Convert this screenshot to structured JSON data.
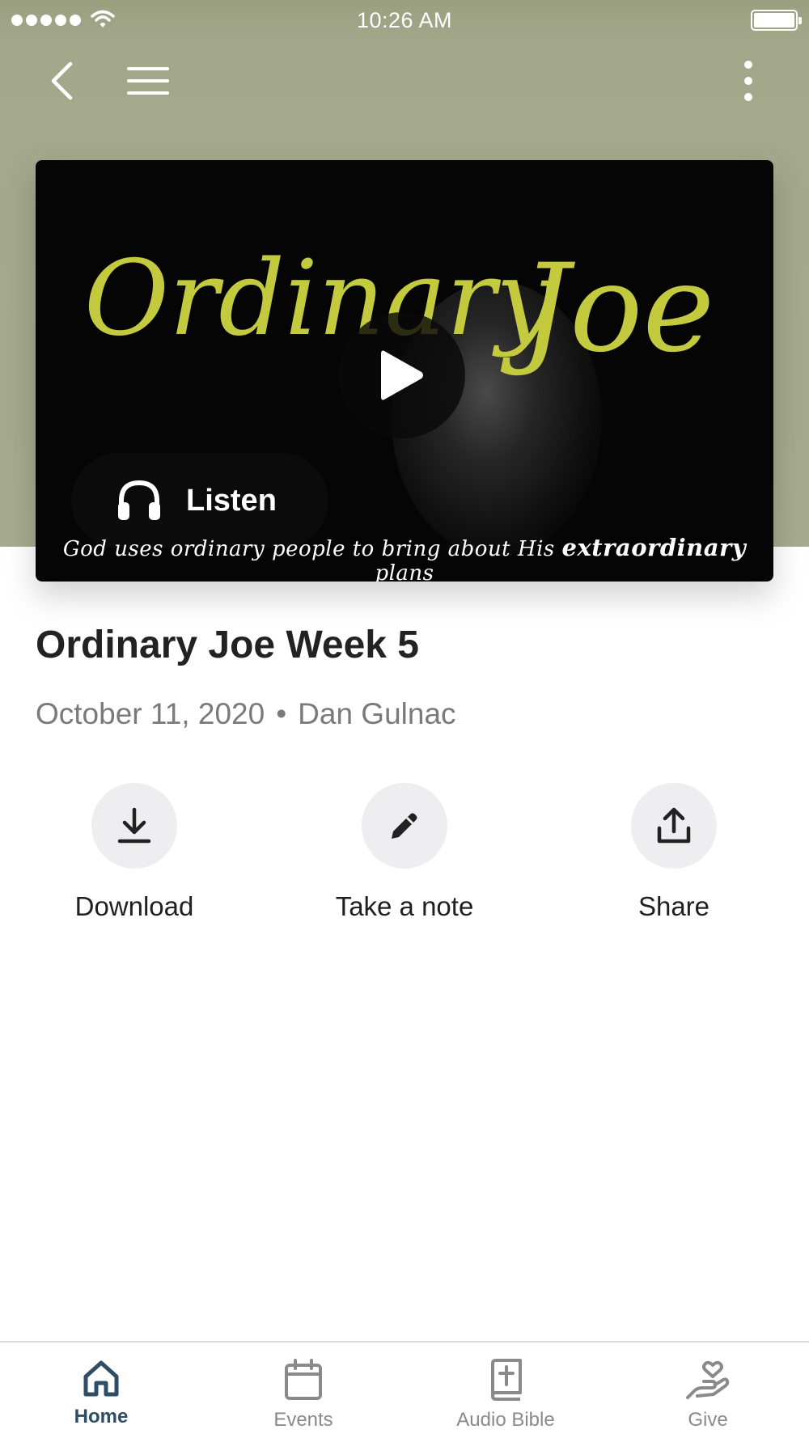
{
  "status_bar": {
    "time": "10:26 AM"
  },
  "nav": {
    "back_icon": "chevron-left-icon",
    "menu_icon": "hamburger-menu-icon",
    "more_icon": "vertical-ellipsis-icon"
  },
  "media": {
    "artwork_title_left": "Ordinary",
    "artwork_title_right": "Joe",
    "tagline_prefix": "God uses ordinary people to bring about His",
    "tagline_emphasis": "extraordinary",
    "tagline_suffix": "plans",
    "listen_label": "Listen",
    "accent_color": "#c3ca3e"
  },
  "sermon": {
    "title": "Ordinary Joe Week 5",
    "date": "October 11, 2020",
    "separator": "•",
    "speaker": "Dan Gulnac"
  },
  "actions": [
    {
      "label": "Download",
      "icon": "download-icon"
    },
    {
      "label": "Take a note",
      "icon": "pencil-icon"
    },
    {
      "label": "Share",
      "icon": "share-icon"
    }
  ],
  "tabs": [
    {
      "label": "Home",
      "icon": "home-icon",
      "active": true
    },
    {
      "label": "Events",
      "icon": "calendar-icon",
      "active": false
    },
    {
      "label": "Audio Bible",
      "icon": "bible-icon",
      "active": false
    },
    {
      "label": "Give",
      "icon": "give-hand-heart-icon",
      "active": false
    }
  ],
  "colors": {
    "header_bg": "#a6aa8e",
    "active_tab": "#2f4e66",
    "inactive_tab": "#8a8a8a"
  }
}
